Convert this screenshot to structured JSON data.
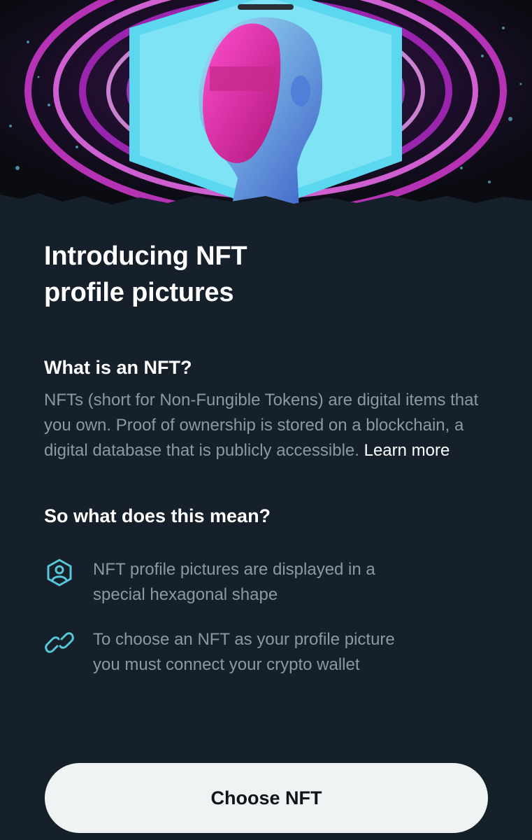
{
  "hero": {
    "image": "nft-hexagon-head-artwork"
  },
  "title": {
    "line1": "Introducing NFT",
    "line2": "profile pictures"
  },
  "what_is": {
    "heading": "What is an NFT?",
    "body": "NFTs (short for Non-Fungible Tokens) are digital items that you own. Proof of ownership is stored on a blockchain, a digital database that is publicly accessible.",
    "learn_more": "Learn more"
  },
  "meaning": {
    "heading": "So what does this mean?",
    "items": [
      {
        "icon": "hexagon-profile-icon",
        "text_line1": "NFT profile pictures are displayed in a",
        "text_line2": "special hexagonal shape"
      },
      {
        "icon": "link-icon",
        "text_line1": "To choose an NFT as your profile picture",
        "text_line2": "you must connect your crypto wallet"
      }
    ]
  },
  "cta": {
    "label": "Choose NFT"
  },
  "colors": {
    "background": "#15202b",
    "heading": "#ffffff",
    "body_text": "#8b98a5",
    "accent_teal": "#56c8d8",
    "hero_magenta": "#e040c8",
    "hero_cyan": "#6ee0f2",
    "button_bg": "#eff3f4"
  }
}
